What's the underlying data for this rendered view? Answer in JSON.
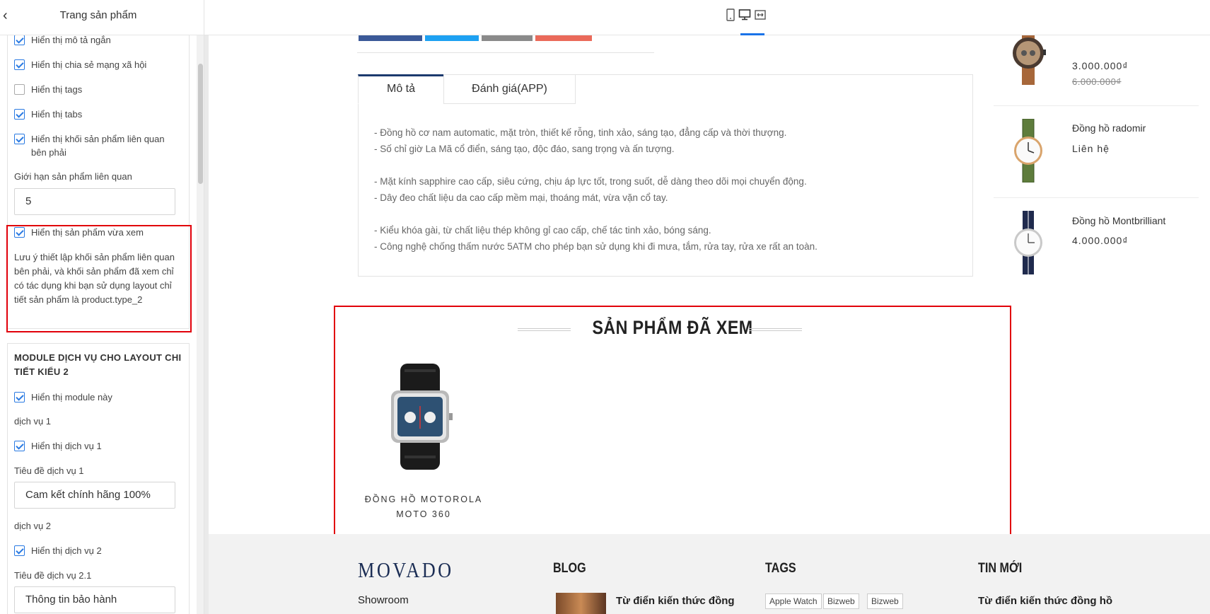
{
  "sidebar": {
    "title": "Trang sản phẩm",
    "checkboxes_top": [
      {
        "label": "Hiển thị mô tả ngắn",
        "checked": true
      },
      {
        "label": "Hiển thị chia sẻ mạng xã hội",
        "checked": true
      },
      {
        "label": "Hiển thị tags",
        "checked": false
      },
      {
        "label": "Hiển thị tabs",
        "checked": true
      },
      {
        "label": "Hiển thị khối sản phẩm liên quan bên phải",
        "checked": true
      }
    ],
    "related_limit_label": "Giới hạn sản phẩm liên quan",
    "related_limit_value": "5",
    "recently_viewed": {
      "label": "Hiển thị sản phẩm vừa xem",
      "checked": true
    },
    "note": "Lưu ý thiết lập khối sản phẩm liên quan bên phải, và khối sản phẩm đã xem chỉ có tác dụng khi bạn sử dụng layout chỉ tiết sản phẩm là product.type_2",
    "service_module": {
      "title": "MODULE DỊCH VỤ CHO LAYOUT CHI TIẾT KIỂU 2",
      "show_module_label": "Hiển thị module này",
      "service1_group": "dịch vụ 1",
      "service1_show_label": "Hiển thị dịch vụ 1",
      "service1_title_label": "Tiêu đề dịch vụ 1",
      "service1_title_value": "Cam kết chính hãng 100%",
      "service2_group": "dịch vụ 2",
      "service2_show_label": "Hiển thị dịch vụ 2",
      "service2_title_label": "Tiêu đề dịch vụ 2.1",
      "service2_title_value": "Thông tin bảo hành"
    }
  },
  "toolbar": {
    "icons": [
      "mobile-icon",
      "desktop-icon",
      "fullwidth-icon"
    ],
    "active": "desktop-icon"
  },
  "product": {
    "tabs": [
      {
        "label": "Mô tả",
        "active": true
      },
      {
        "label": "Đánh giá(APP)",
        "active": false
      }
    ],
    "description": [
      "- Đồng hồ cơ nam automatic, mặt tròn, thiết kế rỗng, tinh xảo, sáng tạo, đẳng cấp và thời thượng.",
      "- Số chỉ giờ La Mã cổ điển, sáng tạo, độc đáo, sang trọng và ấn tượng.",
      "",
      "- Mặt kính sapphire cao cấp, siêu cứng, chịu áp lực tốt, trong suốt, dễ dàng theo dõi mọi chuyển động.",
      "- Dây đeo chất liệu da cao cấp mềm mại, thoáng mát, vừa vặn cổ tay.",
      "",
      "- Kiểu khóa gài, từ chất liệu thép không gỉ cao cấp, chế tác tinh xảo, bóng sáng.",
      "- Công nghệ chống thấm nước 5ATM cho phép bạn sử dụng khi đi mưa, tắm,  rửa tay, rửa xe rất an toàn."
    ]
  },
  "related_products": [
    {
      "name": "",
      "price": "3.000.000₫",
      "old_price": "6.000.000₫"
    },
    {
      "name": "Đồng hồ radomir",
      "price": "Liên hệ",
      "old_price": ""
    },
    {
      "name": "Đồng hồ Montbrilliant",
      "price": "4.000.000₫",
      "old_price": ""
    }
  ],
  "recently_viewed_block": {
    "title": "SẢN PHẨM ĐÃ XEM",
    "items": [
      {
        "name": "ĐỒNG HỒ MOTOROLA MOTO 360"
      }
    ]
  },
  "footer": {
    "logo": "MOVADO",
    "col1_link": "Showroom",
    "blog_heading": "BLOG",
    "blog_item": "Từ điển kiến thức đồng",
    "tags_heading": "TAGS",
    "tags": [
      "Apple Watch",
      "Bizweb",
      "Bizweb"
    ],
    "news_heading": "TIN MỚI",
    "news_item": "Từ điển kiến thức đồng hồ"
  },
  "colors": {
    "accent_blue": "#2a7ae2",
    "highlight_red": "#e1000a",
    "navy": "#1c3a6e",
    "share_facebook": "#3b5998",
    "share_twitter": "#1da1f2",
    "share_email": "#888888",
    "share_google": "#ea6a5a"
  }
}
